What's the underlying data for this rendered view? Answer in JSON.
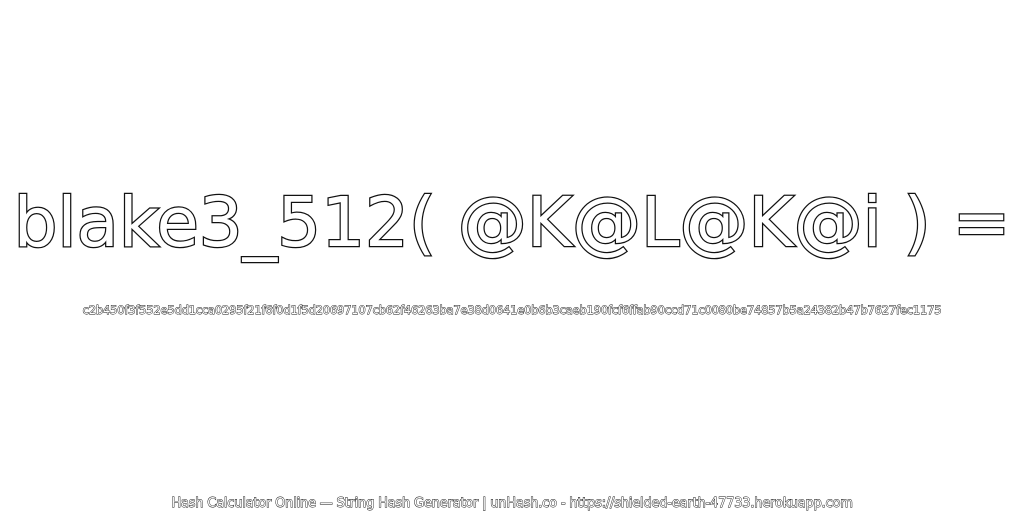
{
  "headline": "blake3_512( @K@L@K@i ) =",
  "hash_value": "c2b450f3f552e5dd1cca0295f21f6f0d1f5d20697107cb62f46263ba7e38d0641e0b6b3caeb190fcf6ffab90ccd71c0080be74857b5a24382b47b7627fec1175",
  "footer": "Hash Calculator Online — String Hash Generator | unHash.co - https://shielded-earth-47733.herokuapp.com",
  "colors": {
    "background": "#ffffff",
    "text_fill": "#ffffff",
    "text_outline": "#111111"
  }
}
